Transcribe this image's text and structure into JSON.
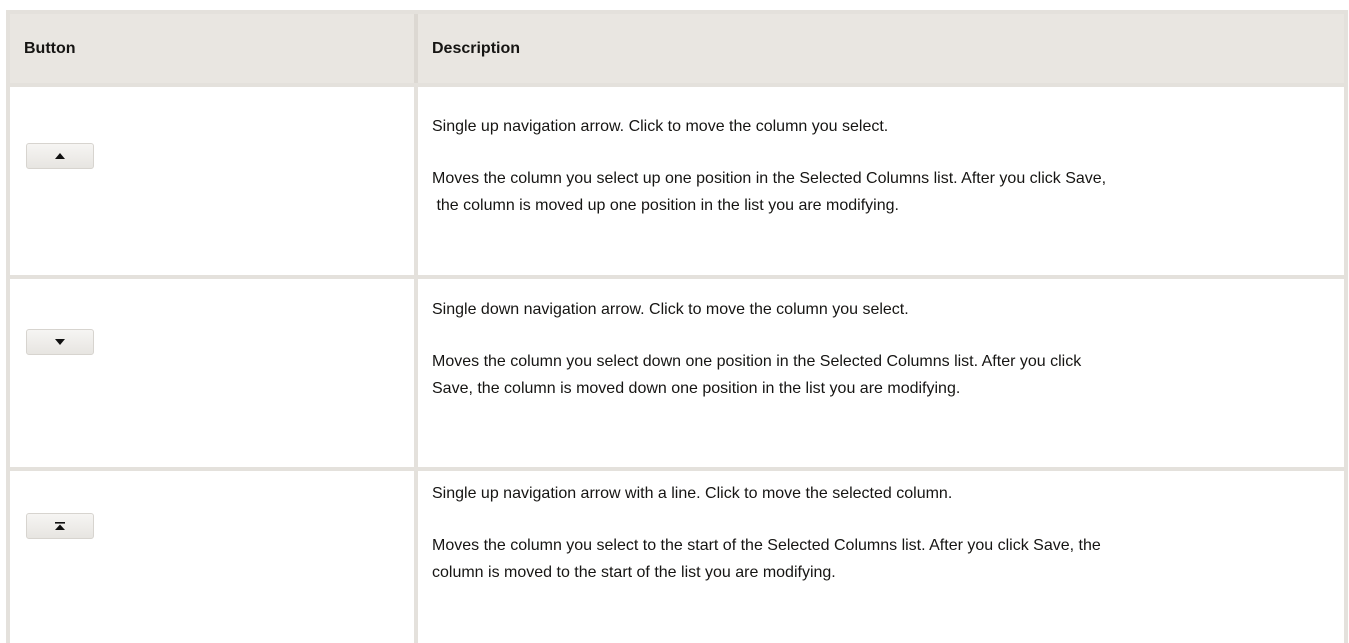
{
  "table": {
    "headers": [
      "Button",
      "Description"
    ],
    "rows": [
      {
        "button_icon": "up-arrow-icon",
        "description": [
          "Single up navigation arrow. Click to move the column you select.",
          "Moves the column you select up one position in the Selected Columns list. After you click Save,",
          " the column is moved up one position in the list you are modifying."
        ]
      },
      {
        "button_icon": "down-arrow-icon",
        "description": [
          "Single down navigation arrow. Click to move the column you select.",
          "Moves the column you select down one position in the Selected Columns list. After you click",
          "Save, the column is moved down one position in the list you are modifying."
        ]
      },
      {
        "button_icon": "move-to-top-icon",
        "description": [
          "Single up navigation arrow with a line. Click to move the selected column.",
          "Moves the column you select to the start of the Selected Columns list. After you click Save, the",
          "column is moved to the start of the list you are modifying."
        ]
      }
    ]
  },
  "colors": {
    "header_background": "#e9e6e1",
    "border": "#e4e1dc",
    "text": "#161513"
  }
}
